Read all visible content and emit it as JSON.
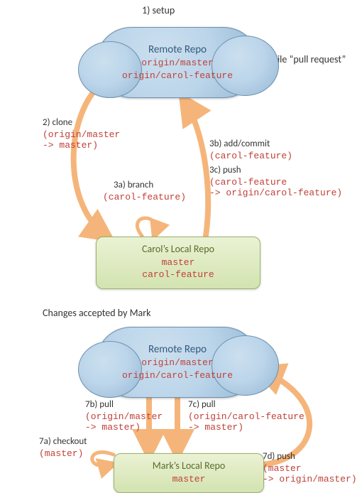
{
  "top": {
    "step1": "1) setup",
    "step4": "4)  File “pull request”",
    "remote": {
      "title": "Remote Repo",
      "branch1": "origin/master",
      "branch2": "origin/carol-feature"
    },
    "step2_label": "2) clone",
    "step2_detail_l1": "(origin/master",
    "step2_detail_l2": "-> master)",
    "step3a_label": "3a) branch",
    "step3a_detail": "(carol-feature)",
    "step3b_label": "3b) add/commit",
    "step3b_detail": "(carol-feature)",
    "step3c_label": "3c) push",
    "step3c_detail_l1": "(carol-feature",
    "step3c_detail_l2": "-> origin/carol-feature)",
    "local": {
      "title": "Carol’s Local Repo",
      "branch1": "master",
      "branch2": "carol-feature"
    }
  },
  "bottom": {
    "section": "Changes accepted by Mark",
    "remote": {
      "title": "Remote Repo",
      "branch1": "origin/master",
      "branch2": "origin/carol-feature"
    },
    "step7a_label": "7a) checkout",
    "step7a_detail": "(master)",
    "step7b_label": "7b) pull",
    "step7b_detail_l1": "(origin/master",
    "step7b_detail_l2": "-> master)",
    "step7c_label": "7c) pull",
    "step7c_detail_l1": "(origin/carol-feature",
    "step7c_detail_l2": "-> master)",
    "step7d_label": "7d) push",
    "step7d_detail_l1": "(master",
    "step7d_detail_l2": "-> origin/master)",
    "local": {
      "title": "Mark’s Local Repo",
      "branch1": "master"
    }
  }
}
